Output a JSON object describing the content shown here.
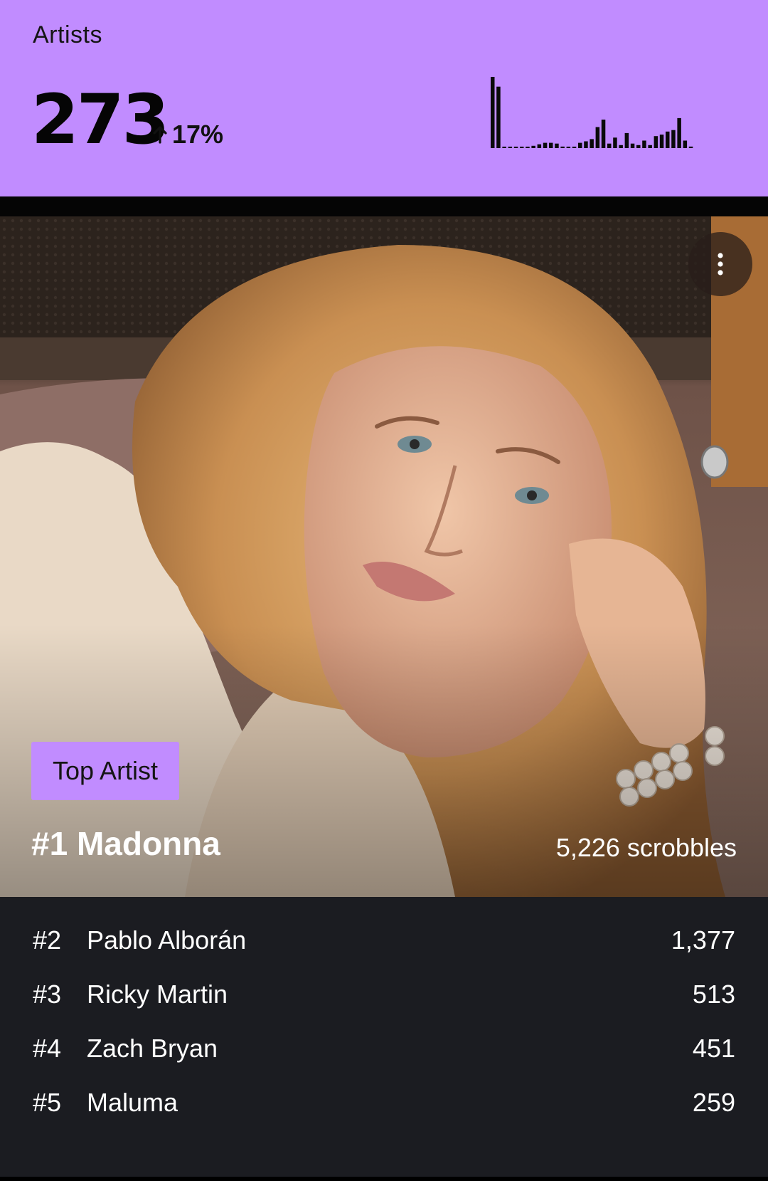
{
  "header": {
    "title": "Artists",
    "count": "273",
    "delta": "17%",
    "delta_direction": "up",
    "accent_color": "#c18cff",
    "sparkline_values": [
      95,
      82,
      0,
      0,
      0,
      0,
      0,
      3,
      5,
      7,
      7,
      6,
      2,
      0,
      0,
      7,
      9,
      12,
      28,
      38,
      6,
      14,
      4,
      20,
      6,
      4,
      10,
      4,
      16,
      18,
      22,
      24,
      40,
      10,
      2
    ]
  },
  "hero": {
    "more_icon": "more-vertical-icon",
    "badge": "Top Artist",
    "name": "#1 Madonna",
    "scrobbles": "5,226 scrobbles"
  },
  "list": {
    "items": [
      {
        "rank": "#2",
        "name": "Pablo Alborán",
        "plays": "1,377"
      },
      {
        "rank": "#3",
        "name": "Ricky Martin",
        "plays": "513"
      },
      {
        "rank": "#4",
        "name": "Zach Bryan",
        "plays": "451"
      },
      {
        "rank": "#5",
        "name": "Maluma",
        "plays": "259"
      }
    ]
  }
}
